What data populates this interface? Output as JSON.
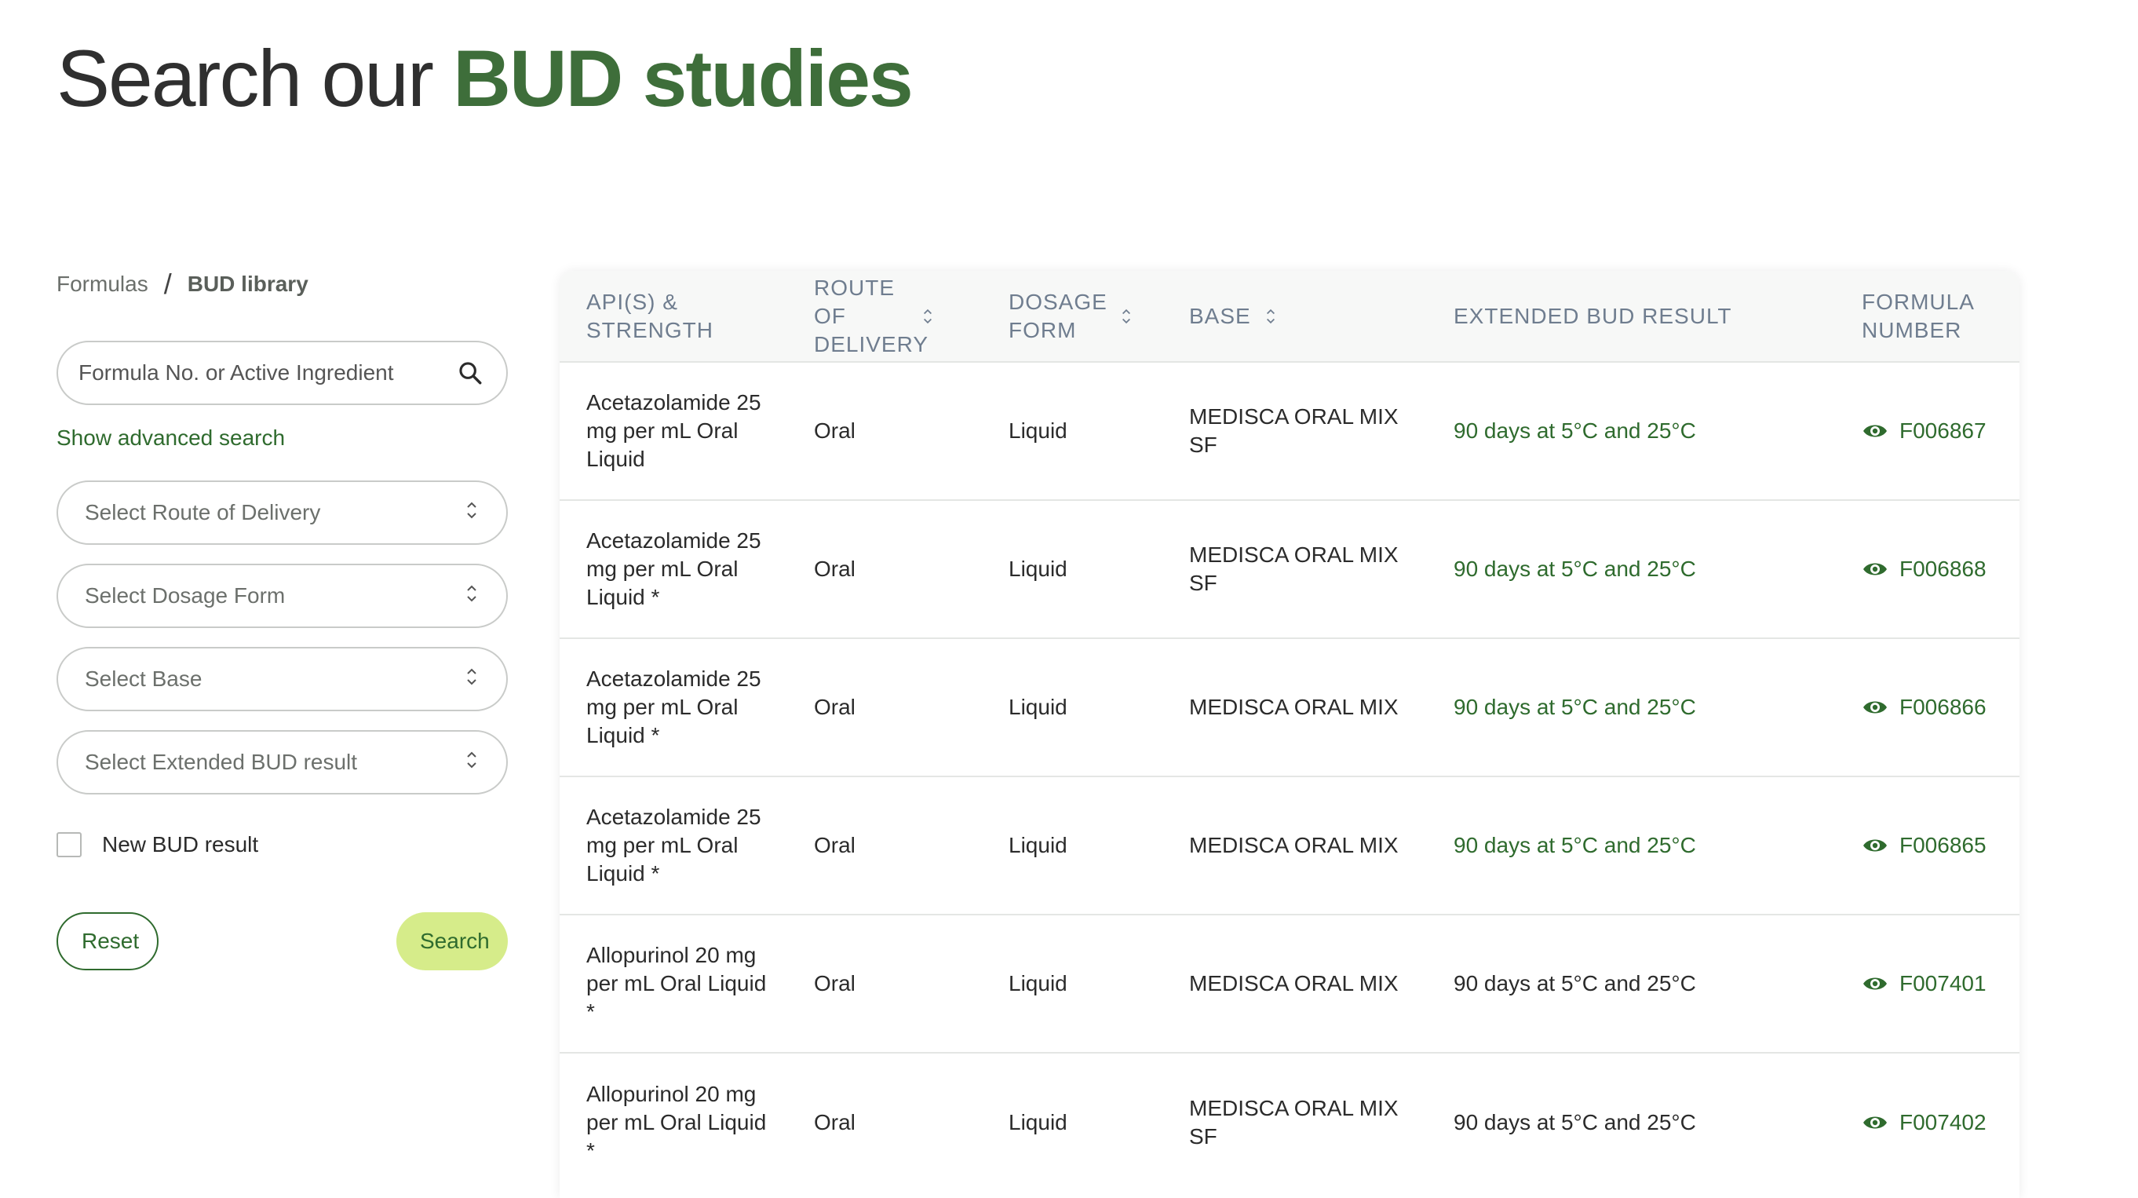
{
  "title": {
    "prefix": "Search our ",
    "accent": "BUD studies"
  },
  "breadcrumb": {
    "parent": "Formulas",
    "separator": "/",
    "current": "BUD library"
  },
  "search": {
    "placeholder": "Formula No. or Active Ingredient",
    "value": "",
    "icon": "search-icon"
  },
  "advanced_search_label": "Show advanced search",
  "selects": [
    {
      "label": "Select Route of Delivery"
    },
    {
      "label": "Select Dosage Form"
    },
    {
      "label": "Select Base"
    },
    {
      "label": "Select Extended BUD result"
    }
  ],
  "new_bud_label": "New BUD result",
  "buttons": {
    "reset": "Reset",
    "search": "Search"
  },
  "colors": {
    "accent": "#3e6e3a",
    "link": "#2f6b2e",
    "search_button": "#d6ec8a",
    "header_text": "#6f7d8f"
  },
  "table": {
    "headers": {
      "api": "API(S) & STRENGTH",
      "route": "ROUTE OF DELIVERY",
      "dosage": "DOSAGE FORM",
      "base": "BASE",
      "result": "EXTENDED BUD RESULT",
      "formula": "FORMULA NUMBER"
    },
    "rows": [
      {
        "api": "Acetazolamide 25 mg per mL Oral Liquid",
        "route": "Oral",
        "dosage": "Liquid",
        "base": "MEDISCA ORAL MIX SF",
        "result": "90 days at 5°C and 25°C",
        "formula": "F006867"
      },
      {
        "api": "Acetazolamide 25 mg per mL Oral Liquid *",
        "route": "Oral",
        "dosage": "Liquid",
        "base": "MEDISCA ORAL MIX SF",
        "result": "90 days at 5°C and 25°C",
        "formula": "F006868"
      },
      {
        "api": "Acetazolamide 25 mg per mL Oral Liquid *",
        "route": "Oral",
        "dosage": "Liquid",
        "base": "MEDISCA ORAL MIX",
        "result": "90 days at 5°C and 25°C",
        "formula": "F006866"
      },
      {
        "api": "Acetazolamide 25 mg per mL Oral Liquid *",
        "route": "Oral",
        "dosage": "Liquid",
        "base": "MEDISCA ORAL MIX",
        "result": "90 days at 5°C and 25°C",
        "formula": "F006865"
      },
      {
        "api": "Allopurinol 20 mg per mL Oral Liquid *",
        "route": "Oral",
        "dosage": "Liquid",
        "base": "MEDISCA ORAL MIX",
        "result": "90 days at 5°C and 25°C",
        "formula": "F007401"
      },
      {
        "api": "Allopurinol 20 mg per mL Oral Liquid *",
        "route": "Oral",
        "dosage": "Liquid",
        "base": "MEDISCA ORAL MIX SF",
        "result": "90 days at 5°C and 25°C",
        "formula": "F007402"
      }
    ]
  }
}
